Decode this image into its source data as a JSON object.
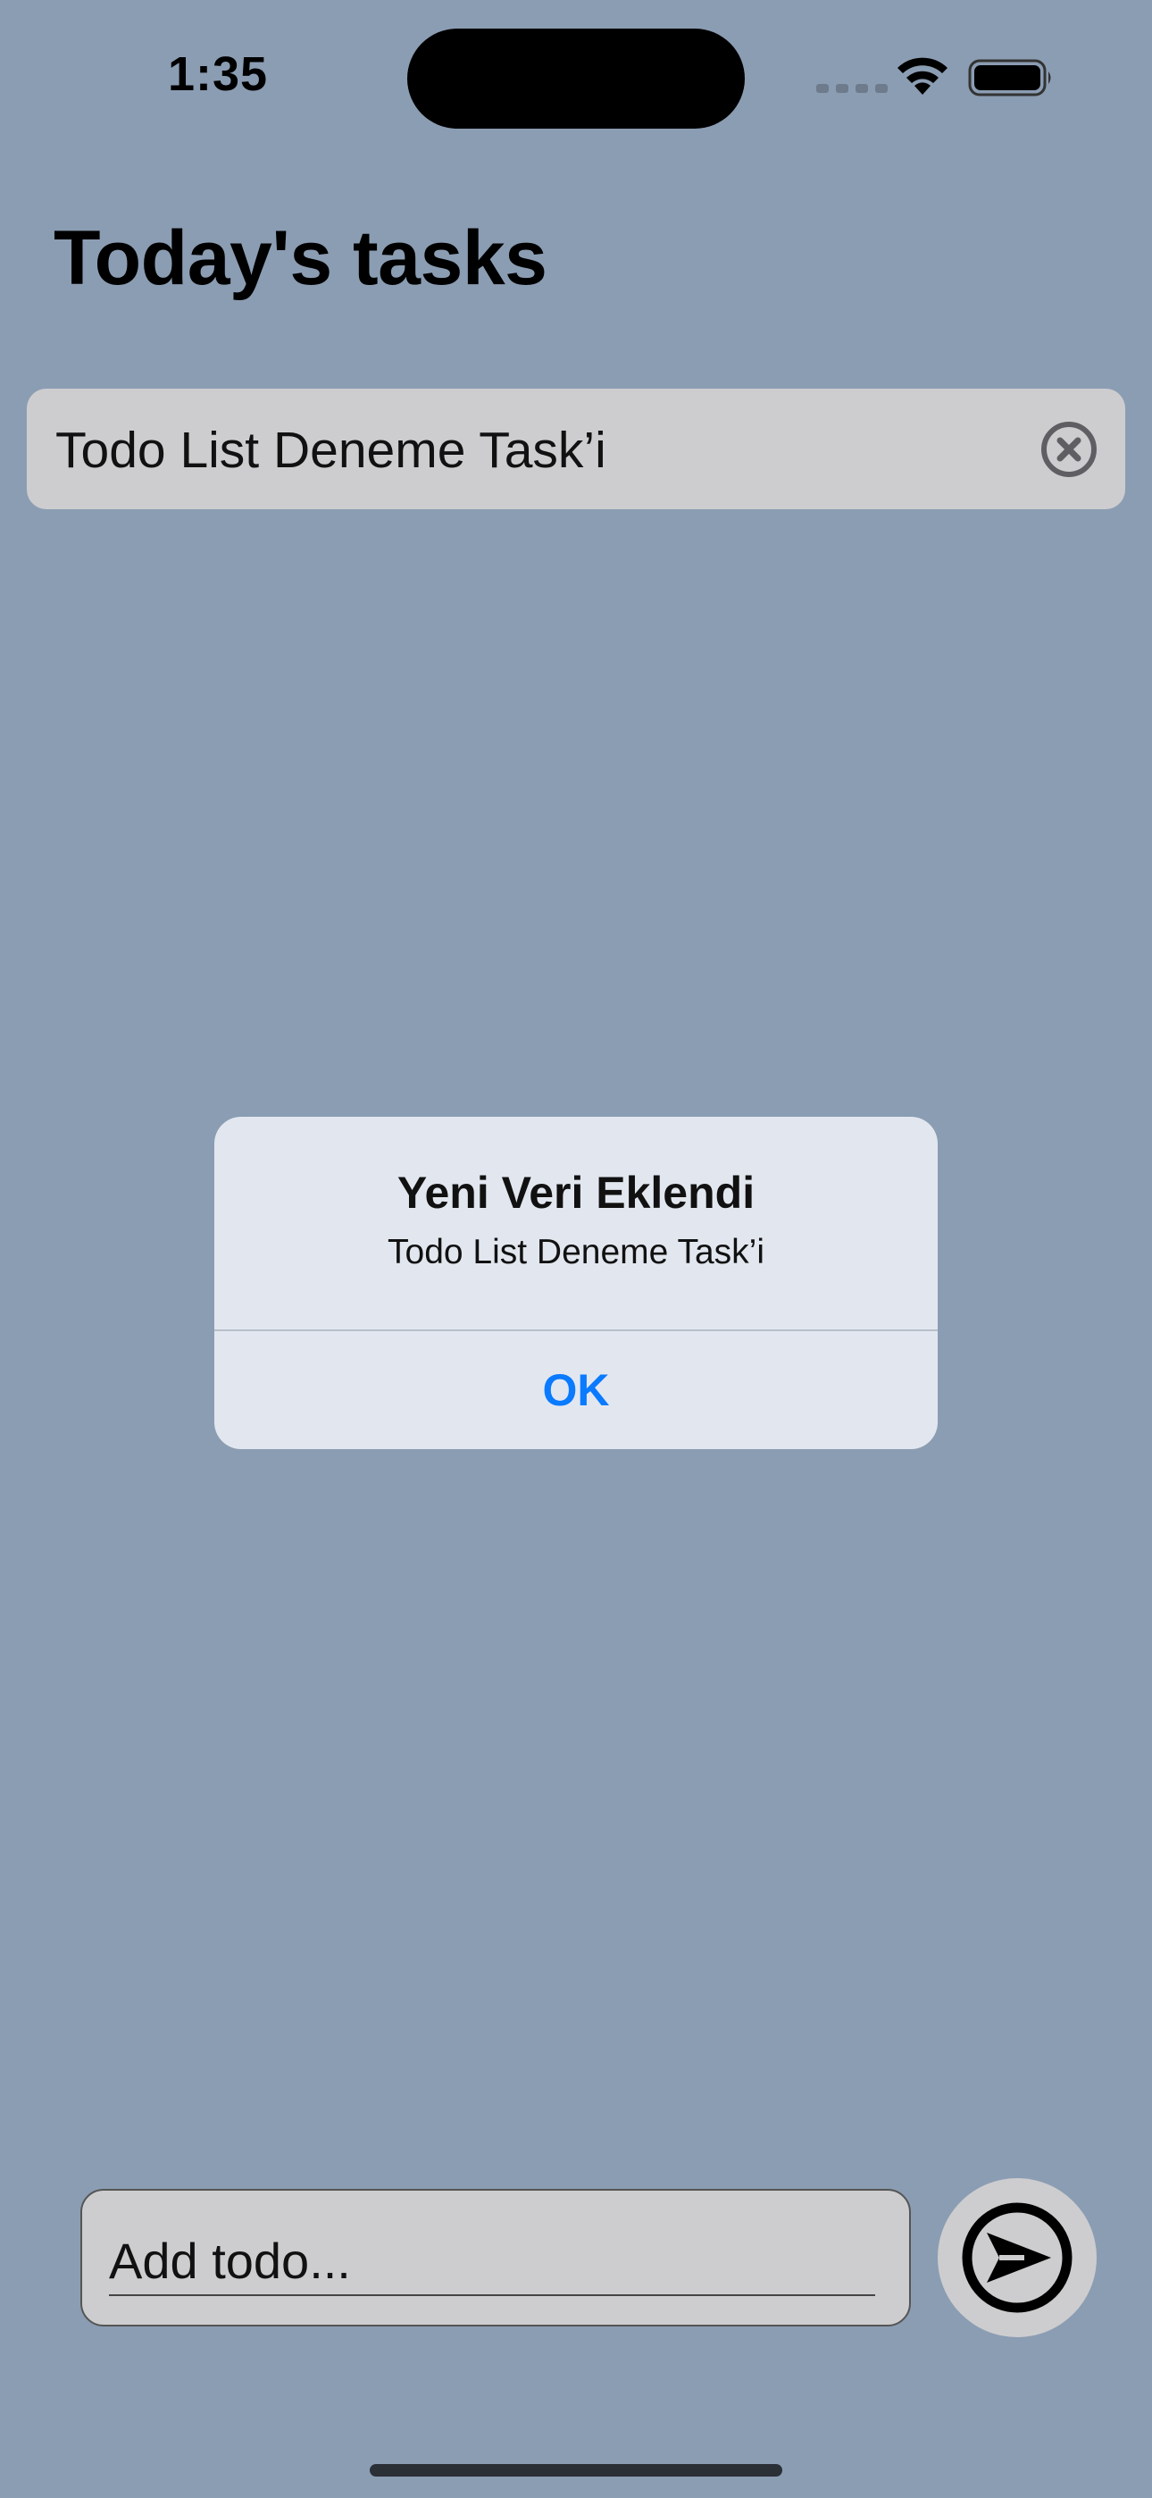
{
  "status_bar": {
    "time": "1:35"
  },
  "page": {
    "title": "Today's tasks",
    "background_color": "#8b9db3"
  },
  "tasks": [
    {
      "label": "Todo List Deneme Task’i",
      "delete_icon": "xmark-circle-icon"
    }
  ],
  "alert": {
    "title": "Yeni Veri Eklendi",
    "message": "Todo List Deneme Task’i",
    "ok_label": "OK",
    "accent_color": "#0a7aff"
  },
  "composer": {
    "placeholder": "Add todo...",
    "value": "",
    "send_icon": "paperplane-circle-icon"
  }
}
